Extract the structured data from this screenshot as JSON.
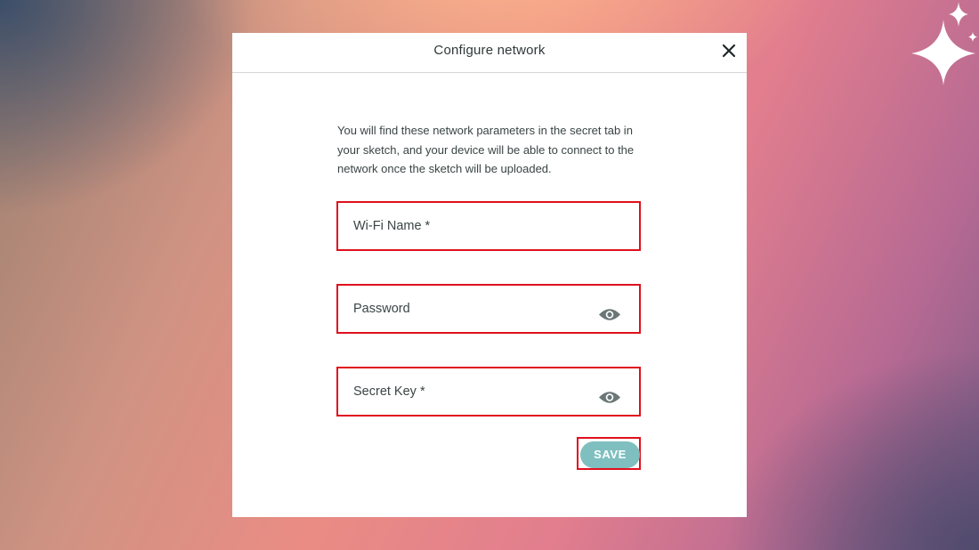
{
  "modal": {
    "title": "Configure network",
    "description": "You will find these network parameters in the secret tab in your sketch, and your device will be able to connect to the network once the sketch will be uploaded.",
    "fields": [
      {
        "label": "Wi-Fi Name *",
        "value": ""
      },
      {
        "label": "Password",
        "value": "",
        "icon": "eye-icon"
      },
      {
        "label": "Secret Key *",
        "value": "",
        "icon": "eye-icon"
      }
    ],
    "save_label": "SAVE"
  },
  "icons": {
    "close": "close-icon",
    "reveal": "eye-icon",
    "decoration": "sparkle-icon"
  },
  "colors": {
    "highlight": "#e0101d",
    "save_button": "#7fbfc0",
    "eye_icon": "#6b7777",
    "modal_background": "#ffffff"
  }
}
